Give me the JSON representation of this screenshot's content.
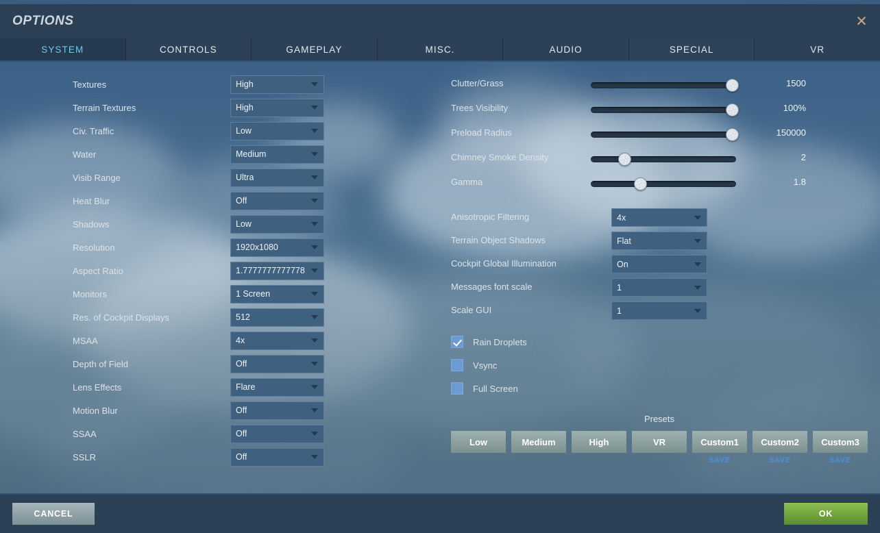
{
  "window": {
    "title": "OPTIONS",
    "close_icon": "close-icon"
  },
  "tabs": [
    {
      "label": "SYSTEM",
      "active": true
    },
    {
      "label": "CONTROLS",
      "active": false
    },
    {
      "label": "GAMEPLAY",
      "active": false
    },
    {
      "label": "MISC.",
      "active": false
    },
    {
      "label": "AUDIO",
      "active": false
    },
    {
      "label": "SPECIAL",
      "active": false
    },
    {
      "label": "VR",
      "active": false
    }
  ],
  "left_settings": [
    {
      "label": "Textures",
      "value": "High"
    },
    {
      "label": "Terrain Textures",
      "value": "High"
    },
    {
      "label": "Civ. Traffic",
      "value": "Low"
    },
    {
      "label": "Water",
      "value": "Medium"
    },
    {
      "label": "Visib Range",
      "value": "Ultra"
    },
    {
      "label": "Heat Blur",
      "value": "Off"
    },
    {
      "label": "Shadows",
      "value": "Low"
    },
    {
      "label": "Resolution",
      "value": "1920x1080"
    },
    {
      "label": "Aspect Ratio",
      "value": "1.7777777777778"
    },
    {
      "label": "Monitors",
      "value": "1 Screen"
    },
    {
      "label": "Res. of Cockpit Displays",
      "value": "512"
    },
    {
      "label": "MSAA",
      "value": "4x"
    },
    {
      "label": "Depth of Field",
      "value": "Off"
    },
    {
      "label": "Lens Effects",
      "value": "Flare"
    },
    {
      "label": "Motion Blur",
      "value": "Off"
    },
    {
      "label": "SSAA",
      "value": "Off"
    },
    {
      "label": "SSLR",
      "value": "Off"
    }
  ],
  "sliders": [
    {
      "label": "Clutter/Grass",
      "value": "1500",
      "percent": 97
    },
    {
      "label": "Trees Visibility",
      "value": "100%",
      "percent": 97
    },
    {
      "label": "Preload Radius",
      "value": "150000",
      "percent": 97
    },
    {
      "label": "Chimney Smoke Density",
      "value": "2",
      "percent": 23
    },
    {
      "label": "Gamma",
      "value": "1.8",
      "percent": 34
    }
  ],
  "right_settings": [
    {
      "label": "Anisotropic Filtering",
      "value": "4x"
    },
    {
      "label": "Terrain Object Shadows",
      "value": "Flat"
    },
    {
      "label": "Cockpit Global Illumination",
      "value": "On"
    },
    {
      "label": "Messages font scale",
      "value": "1"
    },
    {
      "label": "Scale GUI",
      "value": "1"
    }
  ],
  "checkboxes": [
    {
      "label": "Rain Droplets",
      "checked": true
    },
    {
      "label": "Vsync",
      "checked": false
    },
    {
      "label": "Full Screen",
      "checked": false
    }
  ],
  "presets": {
    "title": "Presets",
    "buttons": [
      {
        "label": "Low",
        "save": ""
      },
      {
        "label": "Medium",
        "save": ""
      },
      {
        "label": "High",
        "save": ""
      },
      {
        "label": "VR",
        "save": ""
      },
      {
        "label": "Custom1",
        "save": "SAVE"
      },
      {
        "label": "Custom2",
        "save": "SAVE"
      },
      {
        "label": "Custom3",
        "save": "SAVE"
      }
    ]
  },
  "footer": {
    "cancel_label": "CANCEL",
    "ok_label": "OK"
  },
  "colors": {
    "accent_tab": "#6fc8ee",
    "save_link": "#4a90d9",
    "ok_button": "#76a841",
    "checkbox": "#6b9bd2"
  }
}
